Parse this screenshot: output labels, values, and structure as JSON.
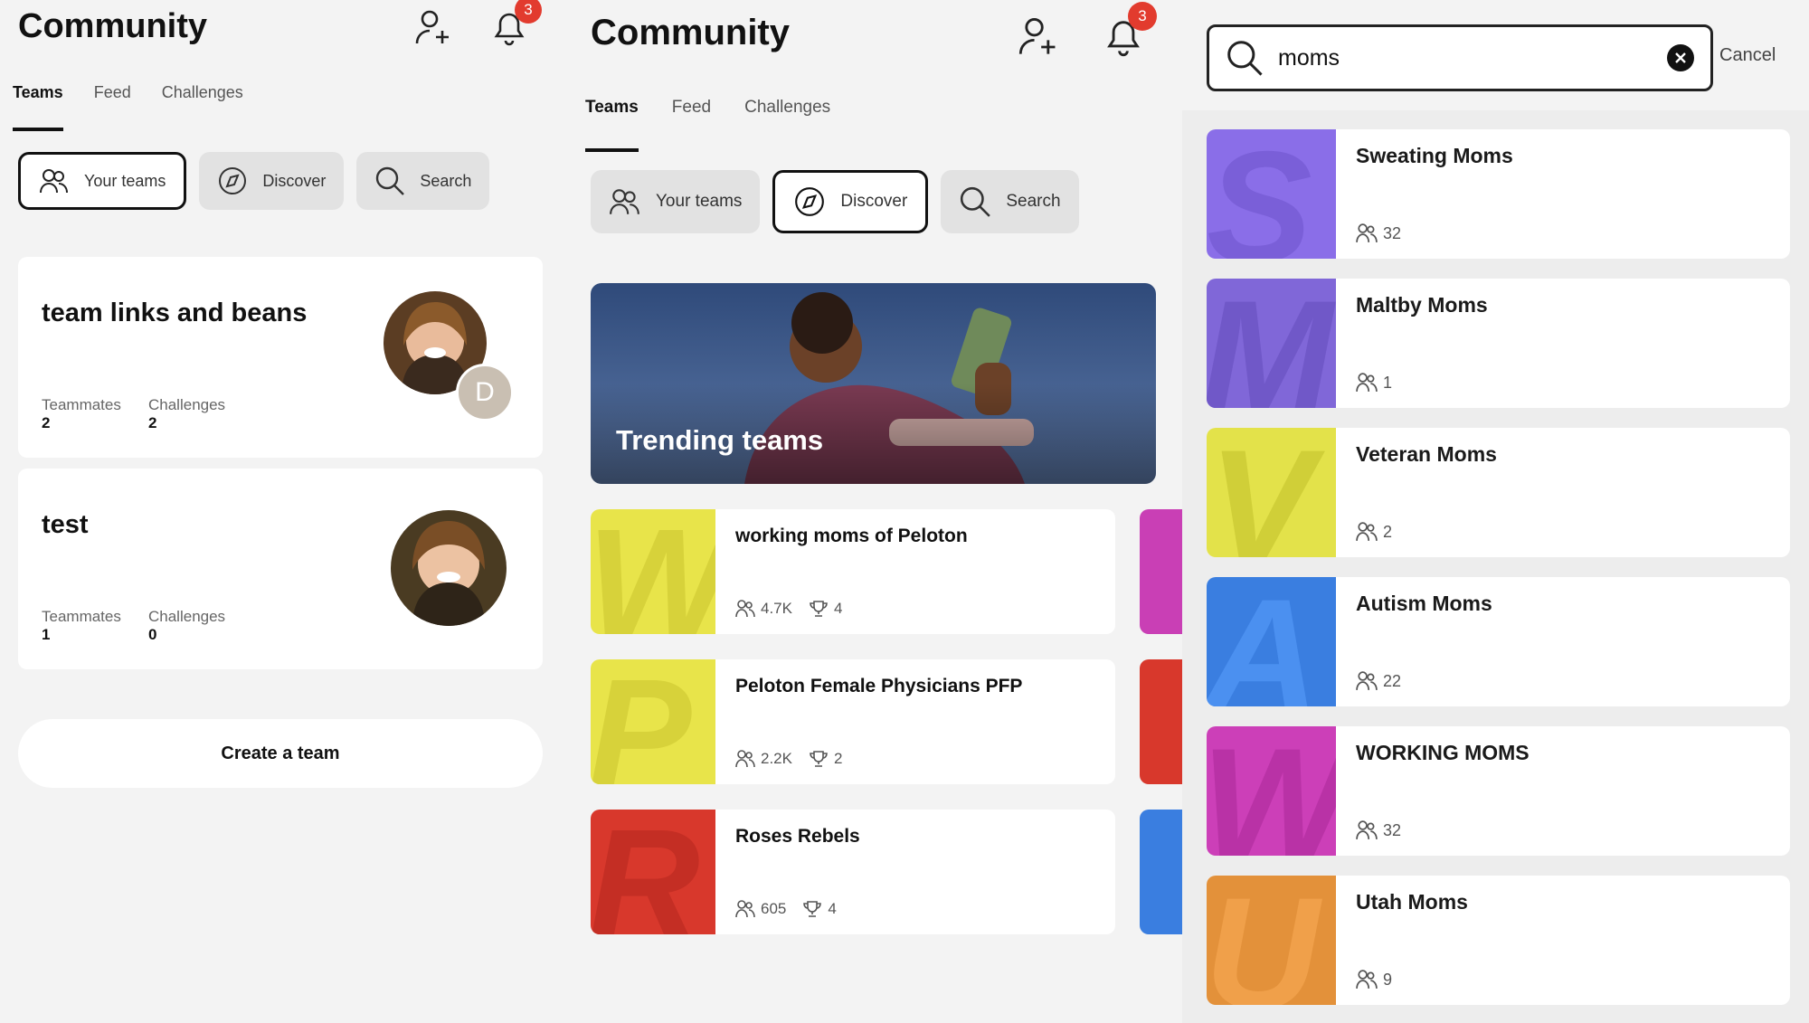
{
  "left": {
    "title": "Community",
    "notification_count": "3",
    "tabs": [
      "Teams",
      "Feed",
      "Challenges"
    ],
    "pills": [
      "Your teams",
      "Discover",
      "Search"
    ],
    "teams": [
      {
        "name": "team links and beans",
        "teammates_label": "Teammates",
        "teammates": "2",
        "challenges_label": "Challenges",
        "challenges": "2",
        "extra_avatar": "D"
      },
      {
        "name": "test",
        "teammates_label": "Teammates",
        "teammates": "1",
        "challenges_label": "Challenges",
        "challenges": "0"
      }
    ],
    "create_label": "Create a team"
  },
  "middle": {
    "title": "Community",
    "notification_count": "3",
    "tabs": [
      "Teams",
      "Feed",
      "Challenges"
    ],
    "pills": [
      "Your teams",
      "Discover",
      "Search"
    ],
    "hero_label": "Trending teams",
    "teams": [
      {
        "letter": "W",
        "name": "working moms of Peloton",
        "members": "4.7K",
        "trophies": "4",
        "color": "#e8e44a"
      },
      {
        "letter": "P",
        "name": "Peloton Female Physicians PFP",
        "members": "2.2K",
        "trophies": "2",
        "color": "#e8e44a"
      },
      {
        "letter": "R",
        "name": "Roses Rebels",
        "members": "605",
        "trophies": "4",
        "color": "#d8382c"
      }
    ],
    "peek_colors": [
      "#c93fb5",
      "#d8382c",
      "#3a7ee0"
    ]
  },
  "right": {
    "search_value": "moms",
    "cancel_label": "Cancel",
    "results": [
      {
        "letter": "S",
        "name": "Sweating Moms",
        "members": "32",
        "color": "#8a6ee8"
      },
      {
        "letter": "M",
        "name": "Maltby Moms",
        "members": "1",
        "color": "#8067d8"
      },
      {
        "letter": "V",
        "name": "Veteran Moms",
        "members": "2",
        "color": "#e3e24a"
      },
      {
        "letter": "A",
        "name": "Autism Moms",
        "members": "22",
        "color": "#3a7ee0"
      },
      {
        "letter": "W",
        "name": "WORKING MOMS",
        "members": "32",
        "color": "#cc3fb8"
      },
      {
        "letter": "U",
        "name": "Utah Moms",
        "members": "9",
        "color": "#e3913a"
      }
    ]
  }
}
